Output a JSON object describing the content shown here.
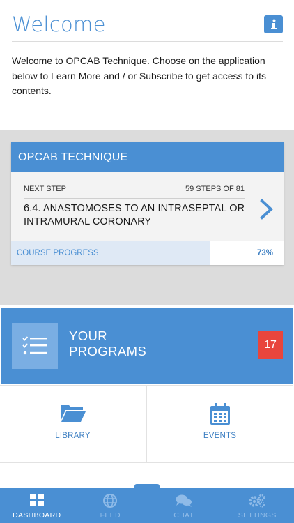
{
  "welcome": {
    "title": "Welcome",
    "text": "Welcome to OPCAB Technique. Choose on the application below to Learn More and / or Subscribe to get access to its contents."
  },
  "course": {
    "title": "OPCAB TECHNIQUE",
    "next_label": "NEXT STEP",
    "steps_count": "59 STEPS OF 81",
    "step_title": "6.4. ANASTOMOSES TO AN INTRASEPTAL OR INTRAMURAL CORONARY",
    "progress_label": "COURSE PROGRESS",
    "progress_text": "73%",
    "progress_value": 0.73
  },
  "programs": {
    "label_line1": "YOUR",
    "label_line2": "PROGRAMS",
    "badge": "17"
  },
  "tiles": [
    {
      "label": "LIBRARY",
      "icon": "folder-icon"
    },
    {
      "label": "EVENTS",
      "icon": "calendar-icon"
    }
  ],
  "tabs": [
    {
      "label": "DASHBOARD",
      "icon": "grid-icon",
      "active": true
    },
    {
      "label": "FEED",
      "icon": "globe-icon",
      "active": false
    },
    {
      "label": "CHAT",
      "icon": "chat-icon",
      "active": false
    },
    {
      "label": "SETTINGS",
      "icon": "gears-icon",
      "active": false
    }
  ],
  "colors": {
    "accent": "#4a8fd3",
    "badge": "#e8453c",
    "section_bg": "#dcdcdc",
    "progress_fill": "#dfe9f5"
  }
}
